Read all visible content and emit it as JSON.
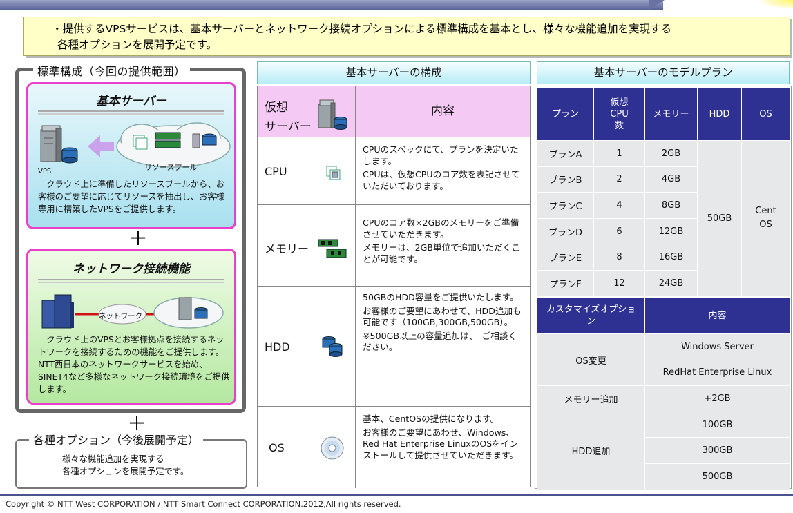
{
  "headline": {
    "line1": "・提供するVPSサービスは、基本サーバーとネットワーク接続オプションによる標準構成を基本とし、様々な機能追加を実現する",
    "line2": "各種オプションを展開予定です。"
  },
  "standard": {
    "title": "標準構成（今回の提供範囲）",
    "server_card": {
      "title": "基本サーバー",
      "vps_label": "VPS",
      "pool_label": "リソースプール",
      "text": "　クラウド上に準備したリソースプールから、お客様のご要望に応じてリソースを抽出し、お客様専用に構築したVPSをご提供します。"
    },
    "plus1": "＋",
    "network_card": {
      "title": "ネットワーク接続機能",
      "network_label": "ネットワーク",
      "text": "　クラウド上のVPSとお客様拠点を接続するネットワークを接続するための機能をご提供します。NTT西日本のネットワークサービスを始め、SINET4など多様なネットワーク接続環境をご提供します。"
    }
  },
  "plus2": "＋",
  "options": {
    "title": "各種オプション（今後展開予定）",
    "line1": "様々な機能追加を実現する",
    "line2": "各種オプションを展開予定です。"
  },
  "composition": {
    "title": "基本サーバーの構成",
    "head_cat_l1": "仮想",
    "head_cat_l2": "サーバー",
    "head_content": "内容",
    "rows": [
      {
        "name": "CPU",
        "p1": "CPUのスペックにて、プランを決定いたします。",
        "p2": "CPUは、仮想CPUのコア数を表記させていただいております。"
      },
      {
        "name": "メモリー",
        "p1": "CPUのコア数×2GBのメモリーをご準備させていただきます。",
        "p2": "メモリーは、2GB単位で追加いただくことが可能です。"
      },
      {
        "name": "HDD",
        "p1": "50GBのHDD容量をご提供いたします。",
        "p2": "お客様のご要望にあわせて、HDD追加も可能です（100GB,300GB,500GB）。",
        "p3": "※500GB以上の容量追加は、　ご相談ください。"
      },
      {
        "name": "OS",
        "p1": "基本、CentOSの提供になります。",
        "p2": "お客様のご要望にあわせ、Windows、Red Hat Enterprise LinuxのOSをインストールして提供させていただきます。"
      }
    ]
  },
  "plans": {
    "title": "基本サーバーのモデルプラン",
    "headers": [
      "プラン",
      "仮想CPU数",
      "メモリー",
      "HDD",
      "OS"
    ],
    "rows": [
      {
        "plan": "プランA",
        "cpu": "1",
        "mem": "2GB"
      },
      {
        "plan": "プランB",
        "cpu": "2",
        "mem": "4GB"
      },
      {
        "plan": "プランC",
        "cpu": "4",
        "mem": "8GB"
      },
      {
        "plan": "プランD",
        "cpu": "6",
        "mem": "12GB"
      },
      {
        "plan": "プランE",
        "cpu": "8",
        "mem": "16GB"
      },
      {
        "plan": "プランF",
        "cpu": "12",
        "mem": "24GB"
      }
    ],
    "hdd": "50GB",
    "os": "Cent OS"
  },
  "custom": {
    "head_left": "カスタマイズオプション",
    "head_right": "内容",
    "os_change": "OS変更",
    "os_opts": [
      "Windows Server",
      "RedHat Enterprise Linux"
    ],
    "mem_add": "メモリー追加",
    "mem_val": "+2GB",
    "hdd_add": "HDD追加",
    "hdd_opts": [
      "100GB",
      "300GB",
      "500GB"
    ]
  },
  "footer": "Copyright © NTT West CORPORATION / NTT Smart Connect CORPORATION.2012,All rights reserved.",
  "colors": {
    "table_header": "#2e3192",
    "card_border": "#e840c8",
    "headline_bg": "#ffffc8"
  }
}
